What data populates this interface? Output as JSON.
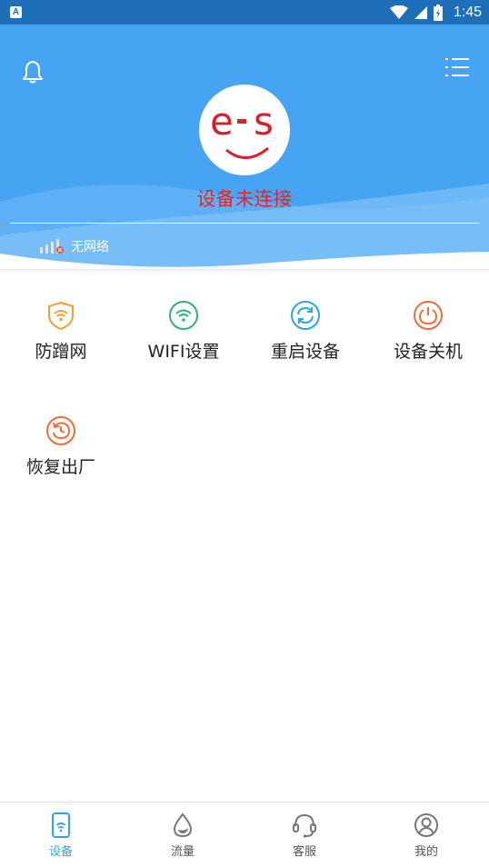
{
  "status_bar": {
    "time": "1:45",
    "app_badge": "A"
  },
  "header": {
    "connection_status": "设备未连接",
    "network_status": "无网络",
    "logo_alt": "e-s"
  },
  "actions": [
    {
      "label": "防蹭网",
      "icon": "shield-wifi-icon",
      "color": "#f0a030"
    },
    {
      "label": "WIFI设置",
      "icon": "wifi-icon",
      "color": "#2fb27a"
    },
    {
      "label": "重启设备",
      "icon": "refresh-icon",
      "color": "#2aa5ea"
    },
    {
      "label": "设备关机",
      "icon": "power-icon",
      "color": "#ee6d35"
    },
    {
      "label": "恢复出厂",
      "icon": "restore-icon",
      "color": "#ee6d35"
    }
  ],
  "bottom_nav": [
    {
      "label": "设备",
      "icon": "device-icon",
      "active": true
    },
    {
      "label": "流量",
      "icon": "drop-icon",
      "active": false
    },
    {
      "label": "客服",
      "icon": "headset-icon",
      "active": false
    },
    {
      "label": "我的",
      "icon": "profile-icon",
      "active": false
    }
  ],
  "colors": {
    "header_bg": "#47a4f3",
    "status_bar_bg": "#1f6fb8",
    "status_text": "#e2262c",
    "nav_active": "#2aa5ea"
  }
}
